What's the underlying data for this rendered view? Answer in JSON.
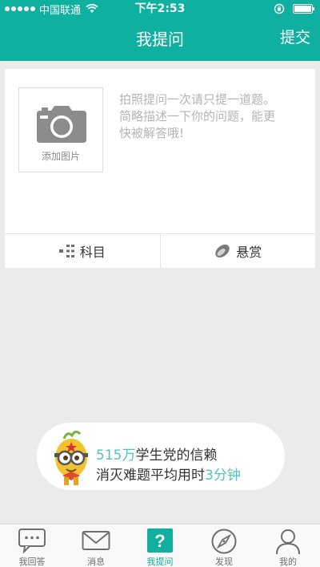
{
  "status_bar": {
    "carrier": "中国联通",
    "time": "下午2:53"
  },
  "nav": {
    "title": "我提问",
    "submit_label": "提交"
  },
  "question": {
    "add_image_label": "添加图片",
    "placeholder": "拍照提问一次请只提一道题。简略描述一下你的问题，能更快被解答哦!",
    "options": [
      {
        "label": "科目",
        "icon": "subject-icon"
      },
      {
        "label": "悬赏",
        "icon": "reward-icon"
      }
    ]
  },
  "promo": {
    "count": "515万",
    "line1_suffix": "学生党的信赖",
    "line2_prefix": "消灭难题平均用时",
    "duration": "3分钟"
  },
  "tabs": [
    {
      "label": "我回答",
      "icon": "chat-bubble-icon",
      "active": false
    },
    {
      "label": "消息",
      "icon": "envelope-icon",
      "active": false
    },
    {
      "label": "我提问",
      "icon": "question-mark-icon",
      "active": true
    },
    {
      "label": "发现",
      "icon": "compass-icon",
      "active": false
    },
    {
      "label": "我的",
      "icon": "person-icon",
      "active": false
    }
  ],
  "colors": {
    "brand": "#0fb0a0",
    "highlight": "#4fc3c3",
    "background": "#ebebeb"
  }
}
